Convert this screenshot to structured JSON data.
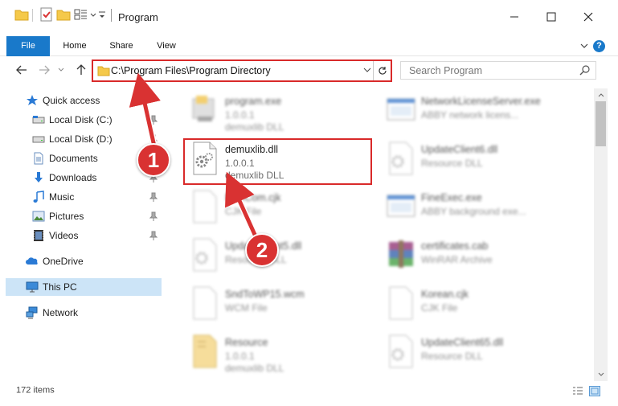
{
  "window": {
    "title": "Program",
    "controls": {
      "minimize": "minimize-icon",
      "maximize": "maximize-icon",
      "close": "close-icon"
    }
  },
  "ribbon": {
    "tabs": [
      {
        "label": "File",
        "active": true
      },
      {
        "label": "Home"
      },
      {
        "label": "Share"
      },
      {
        "label": "View"
      }
    ],
    "help_label": "?"
  },
  "address_bar": {
    "path": "C:\\Program Files\\Program Directory",
    "search_placeholder": "Search Program"
  },
  "sidebar": {
    "items": [
      {
        "label": "Quick access",
        "icon": "star-icon"
      },
      {
        "label": "Local Disk (C:)",
        "icon": "drive-icon",
        "pinned": true
      },
      {
        "label": "Local Disk (D:)",
        "icon": "drive-icon",
        "pinned": true
      },
      {
        "label": "Documents",
        "icon": "documents-icon",
        "pinned": true
      },
      {
        "label": "Downloads",
        "icon": "downloads-icon",
        "pinned": true
      },
      {
        "label": "Music",
        "icon": "music-icon",
        "pinned": true
      },
      {
        "label": "Pictures",
        "icon": "pictures-icon",
        "pinned": true
      },
      {
        "label": "Videos",
        "icon": "videos-icon",
        "pinned": true
      },
      {
        "label": "OneDrive",
        "icon": "onedrive-icon"
      },
      {
        "label": "This PC",
        "icon": "this-pc-icon",
        "selected": true
      },
      {
        "label": "Network",
        "icon": "network-icon"
      }
    ]
  },
  "files": {
    "left": [
      {
        "name": "program.exe",
        "meta1": "1.0.0.1",
        "meta2": "demuxlib DLL",
        "icon": "exe-icon",
        "blurred": true
      },
      {
        "name": "demuxlib.dll",
        "meta1": "1.0.0.1",
        "meta2": "demuxlib DLL",
        "icon": "dll-gear-icon",
        "blurred": false,
        "highlighted": true
      },
      {
        "name": "FineCom.cjk",
        "meta1": "CJK File",
        "meta2": "",
        "icon": "blank-file-icon",
        "blurred": true
      },
      {
        "name": "UpdateClient5.dll",
        "meta1": "Resource DLL",
        "meta2": "",
        "icon": "dll-gear-icon",
        "blurred": true
      },
      {
        "name": "SndToWP15.wcm",
        "meta1": "WCM File",
        "meta2": "",
        "icon": "blank-file-icon",
        "blurred": true
      },
      {
        "name": "Resource",
        "meta1": "1.0.0.1",
        "meta2": "demuxlib DLL",
        "icon": "archive-file-icon",
        "blurred": true
      }
    ],
    "right": [
      {
        "name": "NetworkLicenseServer.exe",
        "meta1": "ABBY network licens...",
        "meta2": "",
        "icon": "window-app-icon",
        "blurred": true
      },
      {
        "name": "UpdateClient6.dll",
        "meta1": "Resource DLL",
        "meta2": "",
        "icon": "dll-gear-icon",
        "blurred": true
      },
      {
        "name": "FineExec.exe",
        "meta1": "ABBY background exe...",
        "meta2": "",
        "icon": "window-app-icon",
        "blurred": true
      },
      {
        "name": "certificates.cab",
        "meta1": "WinRAR Archive",
        "meta2": "",
        "icon": "winrar-icon",
        "blurred": true
      },
      {
        "name": "Korean.cjk",
        "meta1": "CJK File",
        "meta2": "",
        "icon": "blank-file-icon",
        "blurred": true
      },
      {
        "name": "UpdateClient65.dll",
        "meta1": "Resource DLL",
        "meta2": "",
        "icon": "dll-gear-icon",
        "blurred": true
      }
    ]
  },
  "status": {
    "item_count": "172 items"
  },
  "callouts": [
    {
      "label": "1"
    },
    {
      "label": "2"
    }
  ],
  "colors": {
    "accent": "#1979ca",
    "callout": "#d93232",
    "selection": "#cce4f7"
  }
}
